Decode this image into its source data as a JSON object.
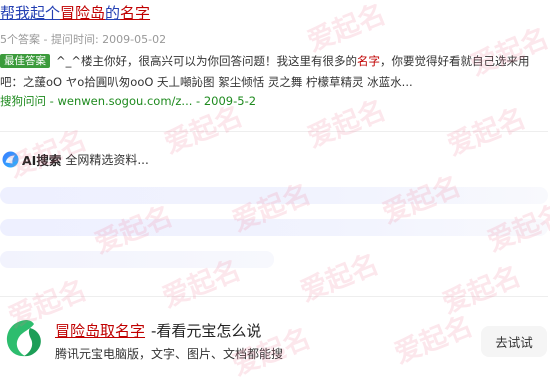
{
  "result": {
    "title_prefix": "帮我起个",
    "title_keyword_1": "冒险岛",
    "title_middle": "的",
    "title_keyword_2": "名字",
    "meta": "5个答案 - 提问时间: 2009-05-02",
    "badge": "最佳答案",
    "snippet_part1": "^_^楼主你好，很高兴可以为你回答问题！我这里有很多的",
    "snippet_keyword": "名字",
    "snippet_part2": "，你要觉得好看就自己选来用吧：之蘐oO ヤo拾圓叭匆ooO 夭丄噸訫图 絮尘倾恬 灵之舞 柠檬草精灵 冰蓝水...",
    "source": "搜狗问问 - wenwen.sogou.com/z... - 2009-5-2"
  },
  "ai": {
    "label": "AI搜索",
    "description": "全网精选资料..."
  },
  "app": {
    "title_keyword": "冒险岛取名字",
    "title_rest": "-看看元宝怎么说",
    "subtitle": "腾讯元宝电脑版，文字、图片、文档都能搜",
    "button_label": "去试试",
    "logo_color": "#2dbd6e"
  },
  "watermark": {
    "text": "爱起名",
    "color": "#f06f8f"
  },
  "colors": {
    "link_blue": "#2440b3",
    "keyword_red": "#c00000",
    "source_green": "#1e8a1e",
    "badge_green": "#3c9b3c"
  }
}
